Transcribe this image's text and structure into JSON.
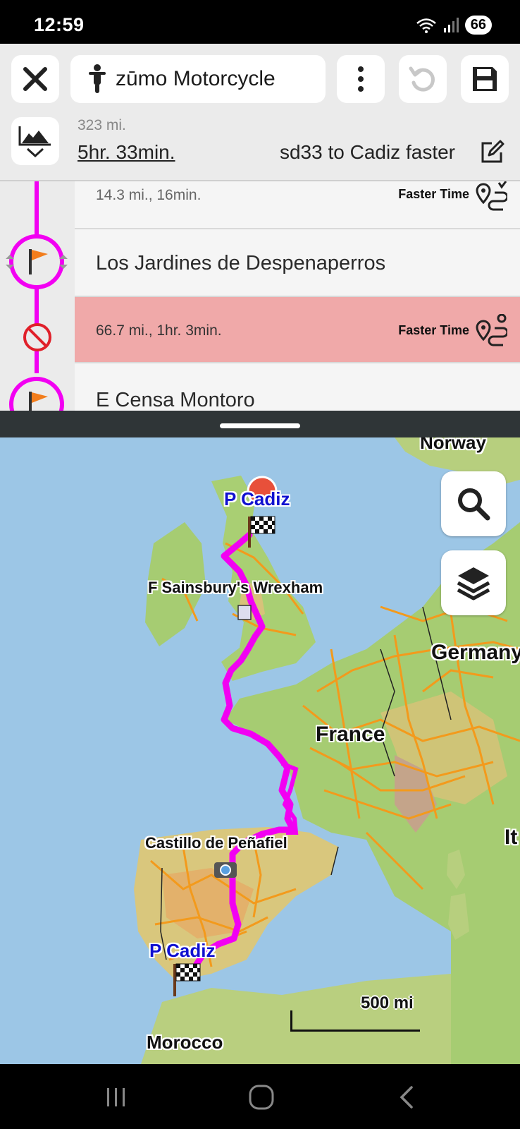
{
  "status_bar": {
    "time": "12:59",
    "battery": "66"
  },
  "toolbar": {
    "device_label": "zūmo Motorcycle"
  },
  "summary": {
    "distance": "323 mi.",
    "duration": "5hr. 33min.",
    "route_name": "sd33 to Cadiz faster"
  },
  "list": {
    "rows": [
      {
        "type": "leg",
        "text": "14.3 mi., 16min.",
        "mode": "Faster Time"
      },
      {
        "type": "waypoint",
        "text": "Los Jardines de Despenaperros"
      },
      {
        "type": "leg",
        "text": "66.7 mi., 1hr. 3min.",
        "mode": "Faster Time",
        "highlighted": true
      },
      {
        "type": "waypoint",
        "text": "E Censa Montoro"
      }
    ]
  },
  "map": {
    "labels": {
      "norway": "Norway",
      "germany": "Germany",
      "france": "France",
      "italy": "It",
      "morocco": "Morocco"
    },
    "pois": {
      "cadiz_top": "P  Cadiz",
      "sainsbury": "F  Sainsbury's  Wrexham",
      "castillo": "Castillo  de  Peñafiel",
      "cadiz_bottom": "P  Cadiz"
    },
    "scale": "500  mi"
  },
  "colors": {
    "route": "#f200f2",
    "highlight_row": "#f0a9a9",
    "roads": "#f39a1c",
    "water": "#9cc6e6"
  },
  "icons": {
    "close": "close-icon",
    "motorcycle": "motorcycle-icon",
    "more": "more-vertical-icon",
    "undo": "undo-icon",
    "save": "save-icon",
    "profile": "elevation-profile-icon",
    "edit": "edit-icon",
    "search": "search-icon",
    "layers": "layers-icon"
  }
}
